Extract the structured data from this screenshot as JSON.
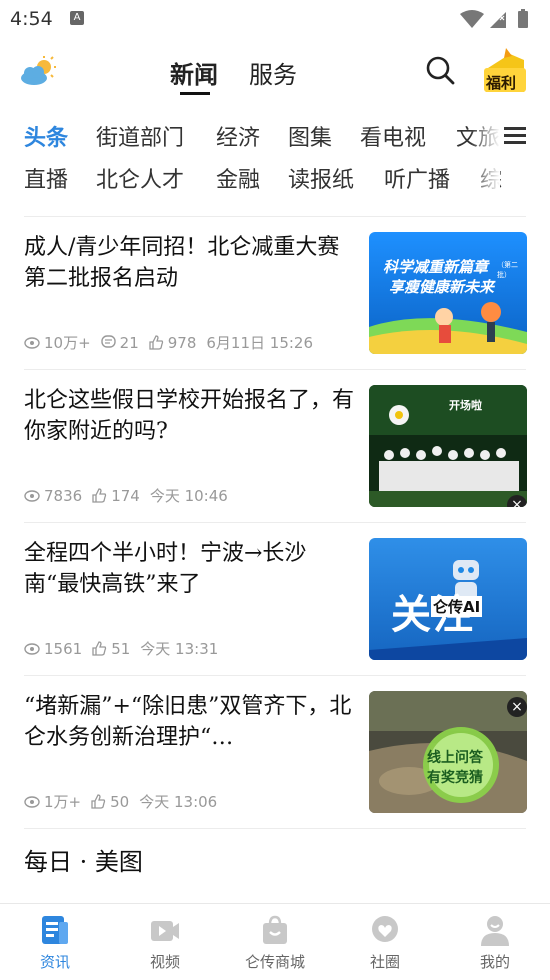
{
  "status": {
    "time": "4:54",
    "notif": "A"
  },
  "top_tabs": [
    "新闻",
    "服务"
  ],
  "welfare_label": "福利",
  "channels_row1": [
    "头条",
    "街道部门",
    "经济",
    "图集",
    "看电视",
    "文旅"
  ],
  "channels_row2": [
    "直播",
    "北仑人才",
    "金融",
    "读报纸",
    "听广播",
    "综"
  ],
  "news": [
    {
      "title": "成人/青少年同招！北仑减重大赛第二批报名启动",
      "views": "10万+",
      "comments": "21",
      "likes": "978",
      "time": "6月11日  15:26",
      "thumb_text1": "科学减重新篇章",
      "thumb_text2": "享瘦健康新未来",
      "thumb_small": "（第二批）"
    },
    {
      "title": "北仑这些假日学校开始报名了，有你家附近的吗?",
      "views": "7836",
      "likes": "174",
      "time": "今天  10:46",
      "thumb_text1": "开场啦"
    },
    {
      "title": "全程四个半小时！宁波→长沙南“最快高铁”来了",
      "views": "1561",
      "likes": "51",
      "time": "今天  13:31",
      "thumb_text1": "关注",
      "thumb_text2": "仑传AI"
    },
    {
      "title": "“堵新漏”+“除旧患”双管齐下，北仑水务创新治理护“…",
      "views": "1万+",
      "likes": "50",
      "time": "今天  13:06",
      "thumb_text1": "线上问答",
      "thumb_text2": "有奖竞猜"
    }
  ],
  "daily_title": "每日 · 美图",
  "bottom_nav": [
    {
      "label": "资讯",
      "icon": "news-icon"
    },
    {
      "label": "视频",
      "icon": "video-icon"
    },
    {
      "label": "仑传商城",
      "icon": "shop-bag-icon"
    },
    {
      "label": "社圈",
      "icon": "community-icon"
    },
    {
      "label": "我的",
      "icon": "profile-icon"
    }
  ],
  "colors": {
    "accent": "#2e86de",
    "text": "#111111",
    "meta": "#999999"
  }
}
